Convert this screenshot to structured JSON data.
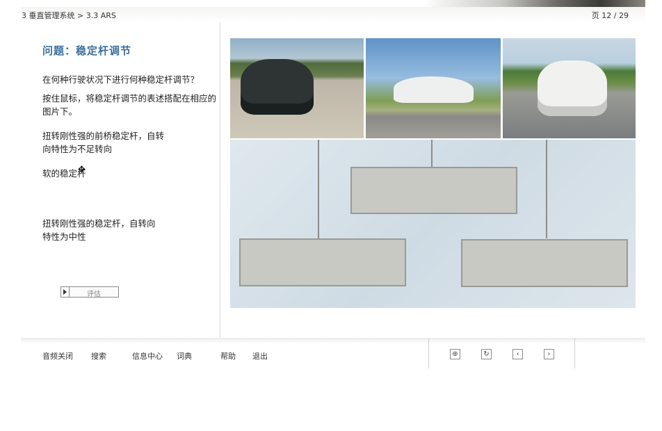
{
  "header": {
    "breadcrumb": "3 垂直管理系统 > 3.3 ARS",
    "page_counter": "页 12 / 29"
  },
  "question": {
    "title": "问题：稳定杆调节",
    "text": "在何种行驶状况下进行何种稳定杆调节？",
    "instruction": "按住鼠标，将稳定杆调节的表述搭配在相应的图片下。"
  },
  "options": [
    "扭转刚性强的前桥稳定杆，自转向特性为不足转向",
    "软的稳定杆",
    "扭转刚性强的稳定杆，自转向特性为中性"
  ],
  "evaluate_button": {
    "label": "评估"
  },
  "footer": {
    "nav": [
      "音频关闭",
      "搜索",
      "信息中心",
      "词典",
      "帮助",
      "退出"
    ]
  },
  "icons": {
    "cursor": "move-cursor-icon",
    "evaluate": "play-triangle-icon",
    "controls": [
      "fit-screen-icon",
      "refresh-icon",
      "chevron-left-icon",
      "chevron-right-icon"
    ]
  },
  "colors": {
    "title": "#3a6f9c",
    "drop_box": "#c9c9c4",
    "drop_area": "#d6e1e8"
  }
}
